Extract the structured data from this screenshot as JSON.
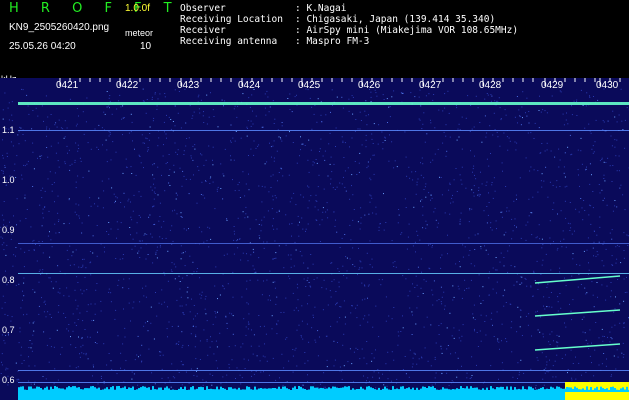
{
  "header": {
    "brand": "H R O F F T",
    "version": "1.0.0f",
    "filename": "KN9_2505260420.png",
    "datetime": "25.05.26 04:20",
    "meteor_label": "meteor",
    "meteor_count": "10"
  },
  "info": [
    {
      "key": "Observer",
      "value": ": K.Nagai"
    },
    {
      "key": "Receiving Location",
      "value": ": Chigasaki, Japan (139.414 35.340)"
    },
    {
      "key": "Receiver",
      "value": ": AirSpy mini (Miakejima VOR 108.65MHz)"
    },
    {
      "key": "Receiving antenna",
      "value": ": Maspro FM-3"
    }
  ],
  "axis": {
    "unit": "kHz",
    "time_ticks": [
      "0421",
      "0422",
      "0423",
      "0424",
      "0425",
      "0426",
      "0427",
      "0428",
      "0429",
      "0430"
    ],
    "freq_ticks": [
      "1.1",
      "1.0",
      "0.9",
      "0.8",
      "0.7",
      "0.6"
    ]
  },
  "colors": {
    "background": "#000000",
    "spectrum_bg": "#0a0a5a",
    "carrier": "#66ffcc",
    "brand": "#22ee22",
    "version": "#ffff33",
    "baseline": "#00ccff",
    "baseline_peak": "#ffff00"
  }
}
